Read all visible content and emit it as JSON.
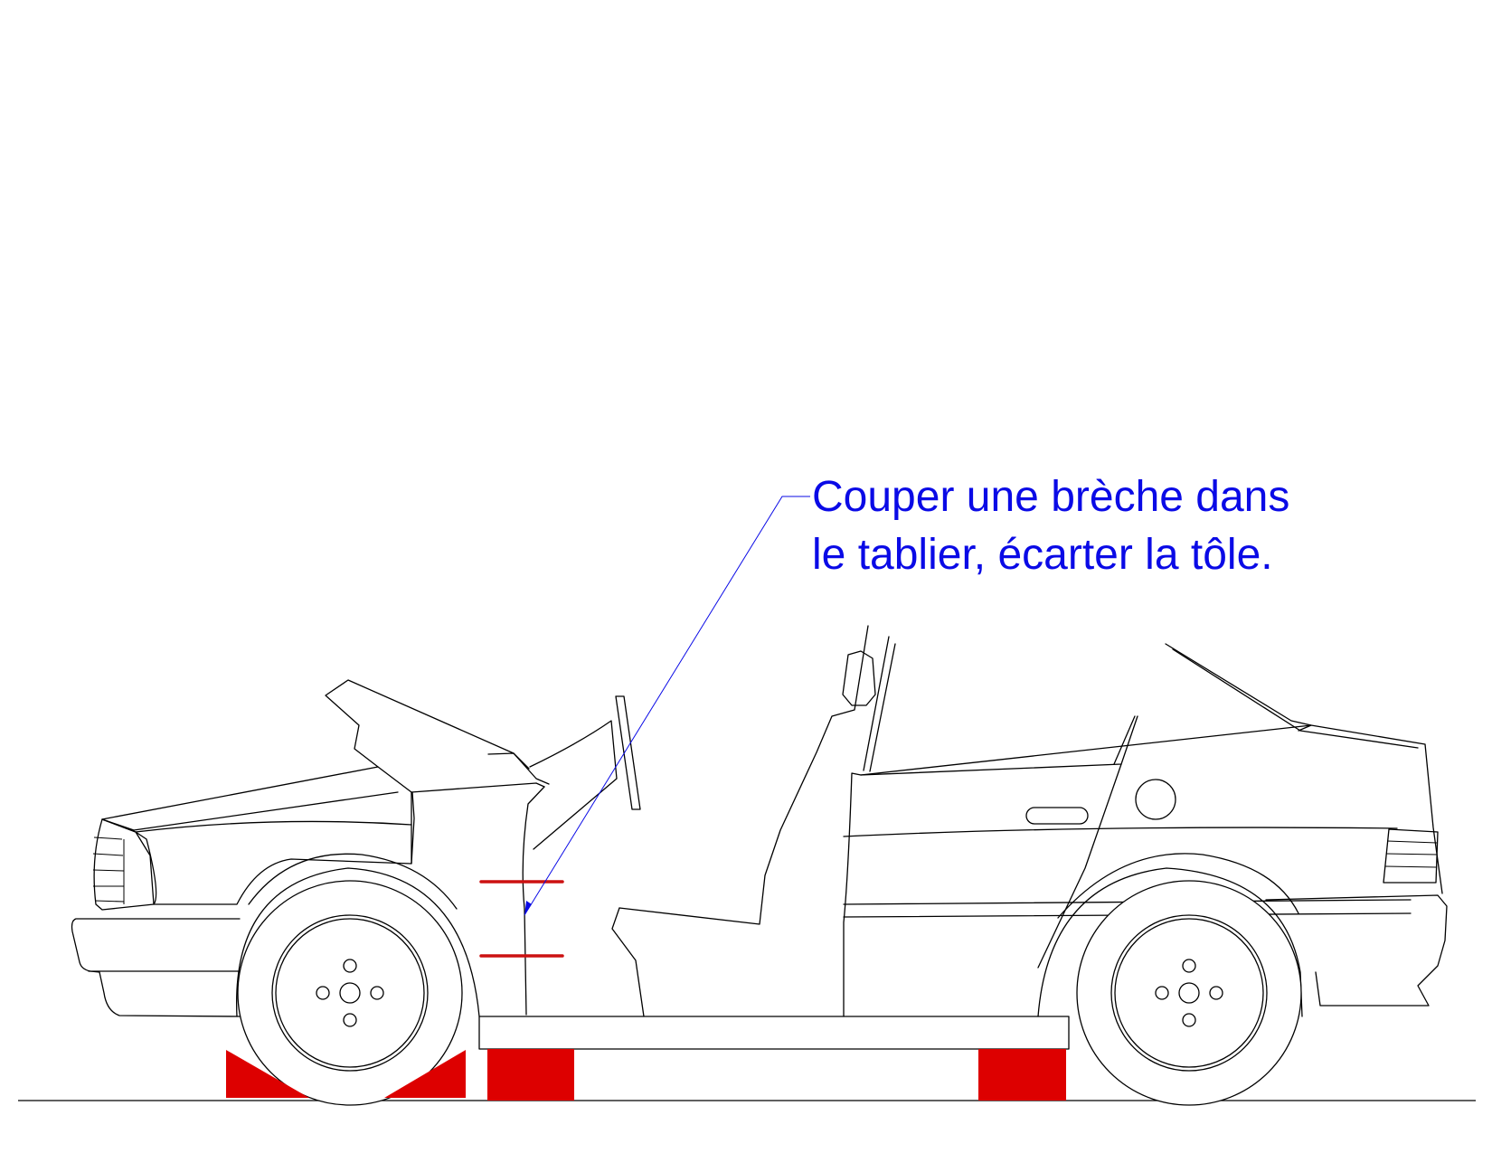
{
  "annotation": {
    "lines": [
      "Couper une brèche dans",
      "le tablier, écarter la tôle."
    ]
  },
  "colors": {
    "annotation": "#0a0ae6",
    "cut_marks": "#cc1111",
    "supports": "#dd0000",
    "outline": "#000000",
    "background": "#ffffff"
  }
}
